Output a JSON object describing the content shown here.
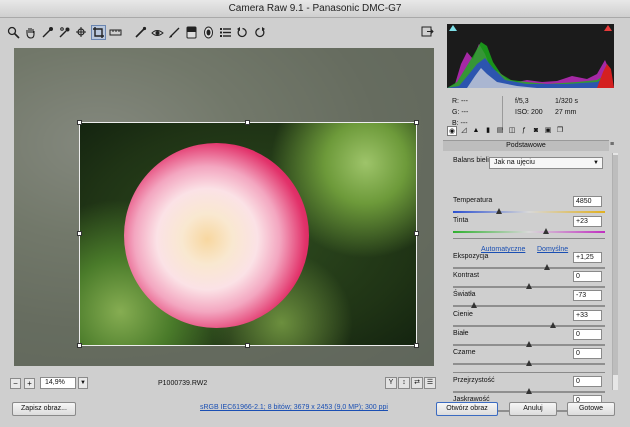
{
  "window": {
    "title": "Camera Raw 9.1  -  Panasonic DMC-G7"
  },
  "toolbar": {
    "tools": [
      "zoom-icon",
      "hand-icon",
      "white-balance-icon",
      "color-sampler-icon",
      "targeted-adjustment-icon",
      "crop-icon",
      "straighten-icon",
      "spot-removal-icon",
      "red-eye-icon",
      "adjustment-brush-icon",
      "graduated-filter-icon",
      "radial-filter-icon",
      "preferences-icon",
      "rotate-ccw-icon",
      "rotate-cw-icon"
    ],
    "selected": "crop-icon"
  },
  "status": {
    "zoom": "14,9%",
    "filename": "P1000739.RW2"
  },
  "info": {
    "r": "R:   ---",
    "g": "G:   ---",
    "b": "B:   ---",
    "aperture": "f/5,3",
    "shutter": "1/320 s",
    "iso": "ISO: 200",
    "focal": "27 mm"
  },
  "panel": {
    "title": "Podstawowe",
    "wb_label": "Balans bieli:",
    "wb_value": "Jak na ujęciu",
    "auto_label": "Automatyczne",
    "default_label": "Domyślne",
    "adjustments": [
      {
        "label": "Temperatura",
        "value": "4850",
        "pos": 0.3
      },
      {
        "label": "Tinta",
        "value": "+23",
        "pos": 0.61
      },
      {
        "label": "Ekspozycja",
        "value": "+1,25",
        "pos": 0.62
      },
      {
        "label": "Kontrast",
        "value": "0",
        "pos": 0.5
      },
      {
        "label": "Światła",
        "value": "-73",
        "pos": 0.14
      },
      {
        "label": "Cienie",
        "value": "+33",
        "pos": 0.66
      },
      {
        "label": "Białe",
        "value": "0",
        "pos": 0.5
      },
      {
        "label": "Czarne",
        "value": "0",
        "pos": 0.5
      },
      {
        "label": "Przejrzystość",
        "value": "0",
        "pos": 0.5
      },
      {
        "label": "Jaskrawość",
        "value": "0",
        "pos": 0.5
      }
    ]
  },
  "bottom": {
    "save_label": "Zapisz obraz...",
    "workflow_link": "sRGB IEC61966-2.1; 8 bitów; 3679 x 2453 (9,0 MP); 300 ppi",
    "open_label": "Otwórz obraz",
    "cancel_label": "Anuluj",
    "done_label": "Gotowe"
  }
}
